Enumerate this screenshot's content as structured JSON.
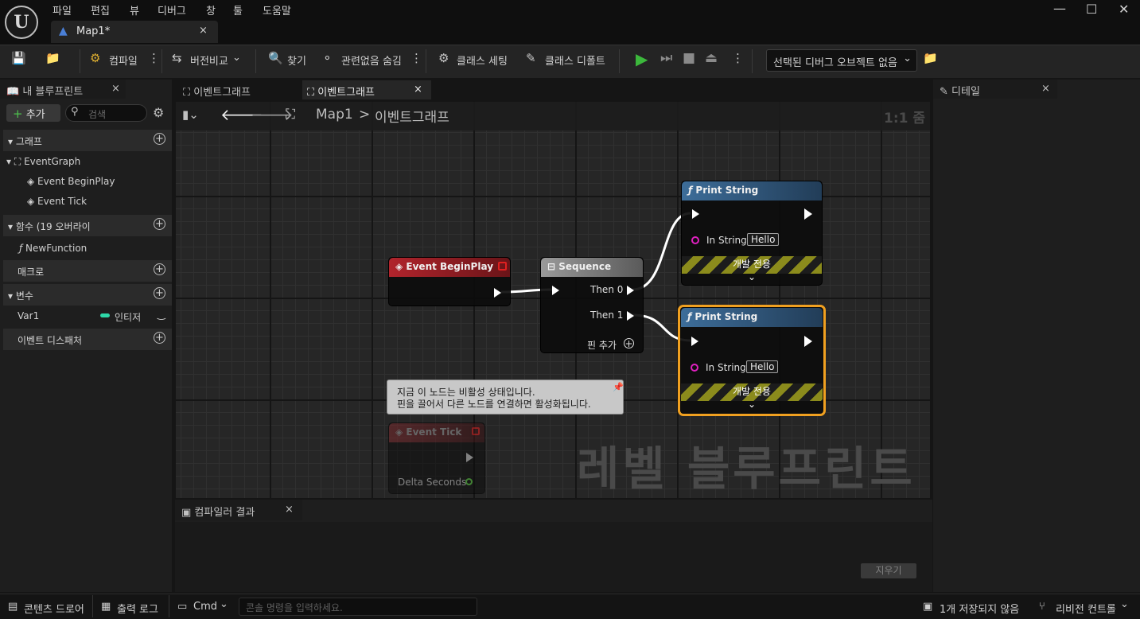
{
  "menu": [
    "파일",
    "편집",
    "뷰",
    "디버그",
    "창",
    "툴",
    "도움말"
  ],
  "doc_tab": {
    "title": "Map1*",
    "close": "×"
  },
  "window_controls": {
    "minimize": "—",
    "maximize": "☐",
    "close": "✕"
  },
  "toolbar": {
    "compile": "컴파일",
    "diff": "버전비교",
    "find": "찾기",
    "hide_unrelated": "관련없음 숨김",
    "class_settings": "클래스 세팅",
    "class_defaults": "클래스 디폴트",
    "debug_object": "선택된 디버그 오브젝트 없음"
  },
  "left_panel": {
    "tab": "내 블루프린트",
    "add_button": "추가",
    "search_placeholder": "검색",
    "sections": {
      "graph": "그래프",
      "functions": "함수 (19 오버라이",
      "macros": "매크로",
      "variables": "변수",
      "dispatchers": "이벤트 디스패처"
    },
    "graph_items": [
      "EventGraph",
      "Event BeginPlay",
      "Event Tick"
    ],
    "function_items": [
      "NewFunction"
    ],
    "variables": [
      {
        "name": "Var1",
        "type": "인티저"
      }
    ]
  },
  "graph_tabs": [
    "이벤트그래프",
    "이벤트그래프"
  ],
  "breadcrumb": {
    "root": "Map1",
    "sep": ">",
    "current": "이벤트그래프"
  },
  "zoom": "1:1 줌",
  "nodes": {
    "begin_play": {
      "title": "Event BeginPlay"
    },
    "sequence": {
      "title": "Sequence",
      "then0": "Then 0",
      "then1": "Then 1",
      "add_pin": "핀 추가"
    },
    "print1": {
      "title": "Print String",
      "in_label": "In String",
      "value": "Hello",
      "dev_only": "개발 전용"
    },
    "print2": {
      "title": "Print String",
      "in_label": "In String",
      "value": "Hello",
      "dev_only": "개발 전용"
    },
    "tick": {
      "title": "Event Tick",
      "delta": "Delta Seconds"
    }
  },
  "tooltip": {
    "line1": "지금 이 노드는 비활성 상태입니다.",
    "line2": "핀을 끌어서 다른 노드를 연결하면 활성화됩니다."
  },
  "watermark": "레벨 블루프린트",
  "compiler": {
    "tab": "컴파일러 결과",
    "clear": "지우기"
  },
  "details": {
    "tab": "디테일"
  },
  "statusbar": {
    "content_drawer": "콘텐츠 드로어",
    "output_log": "출력 로그",
    "cmd": "Cmd",
    "cmd_placeholder": "콘솔 명령을 입력하세요.",
    "unsaved": "1개 저장되지 않음",
    "revision": "리비전 컨트롤"
  },
  "colors": {
    "accent_orange": "#f0a020",
    "exec_red": "#b0242c",
    "func_blue": "#3d6d99",
    "wire": "#ffffff",
    "string_pin": "#e020c0",
    "int_pin": "#2ed8a8"
  }
}
